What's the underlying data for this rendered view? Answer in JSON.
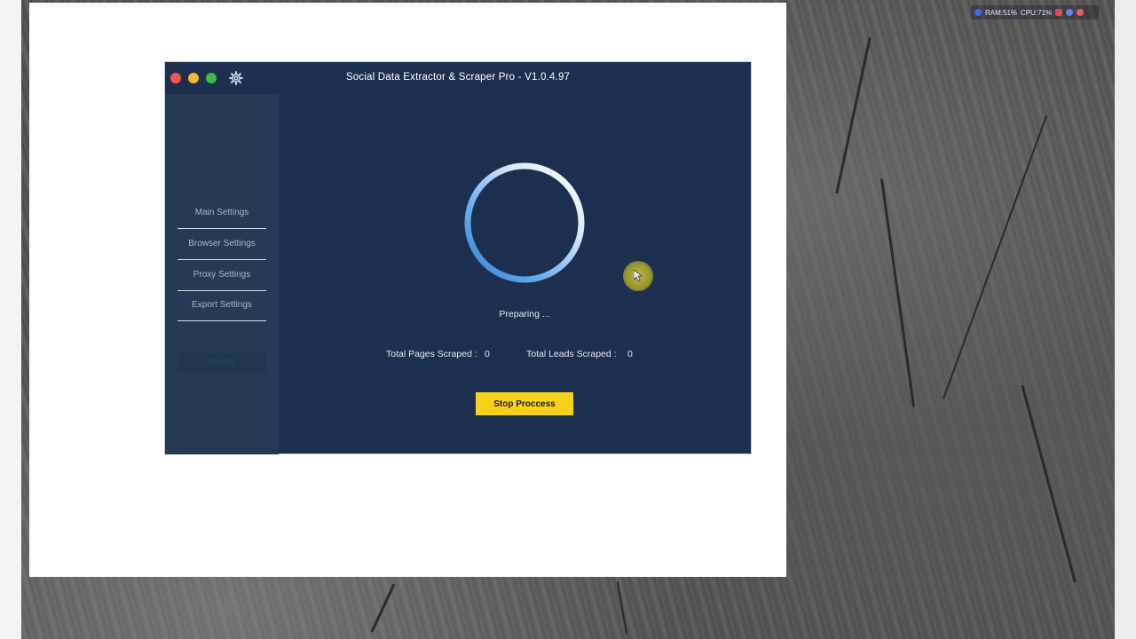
{
  "tray": {
    "ram": "RAM:51%",
    "cpu": "CPU:71%"
  },
  "app": {
    "title": "Social Data Extractor & Scraper  Pro - V1.0.4.97",
    "settings_icon": "gear-icon",
    "sidebar": {
      "items": [
        {
          "label": "Main Settings"
        },
        {
          "label": "Browser Settings"
        },
        {
          "label": "Proxy Settings"
        },
        {
          "label": "Export Settings"
        }
      ],
      "status": "Ready"
    },
    "main": {
      "progress_text": "Preparing ...",
      "total_pages_label": "Total Pages Scraped :",
      "total_pages_value": "0",
      "total_leads_label": "Total Leads Scraped :",
      "total_leads_value": "0",
      "stop_button_label": "Stop Proccess"
    }
  },
  "colors": {
    "app_bg": "#1c2f4f",
    "sidebar_bg": "#243a55",
    "accent_button": "#f7d21a",
    "close": "#f05a4e",
    "minimize": "#f2b83a",
    "maximize": "#41b84a"
  }
}
